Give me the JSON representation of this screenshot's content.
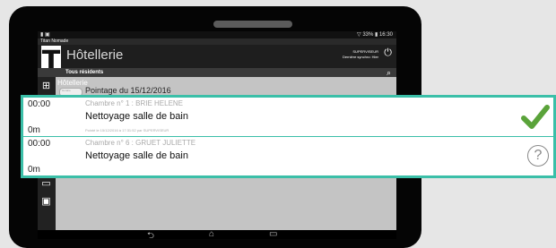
{
  "status": {
    "left": "▮ ▣",
    "right": "▽ 33% ▮ 16:30"
  },
  "app": {
    "name": "Titan Nomade"
  },
  "header": {
    "logo_letter": "T",
    "title": "Hôtellerie",
    "user_role": "SUPERVISEUR",
    "user_subtitle": "Dernière synchro: Hier"
  },
  "subheader": {
    "title": "Tous résidents"
  },
  "section": {
    "label": "Hôtellerie",
    "toggle": "Horaire",
    "pointage": "Pointage du 15/12/2016"
  },
  "tasks": [
    {
      "time": "00:00",
      "room": "Chambre n° 1 : BRIE HELENE",
      "task": "Nettoyage salle de bain",
      "duration": "0m",
      "meta": "Pointé le 15/12/2016 à 17:31:52 par SUPERVISEUR",
      "status": "done"
    },
    {
      "time": "00:00",
      "room": "Chambre n° 6 : GRUET JULIETTE",
      "task": "Nettoyage salle de bain",
      "duration": "0m",
      "meta": "",
      "status": "unknown"
    }
  ],
  "colors": {
    "accent": "#3bbfa8",
    "check": "#5aa33a"
  },
  "icons": {
    "back": "back-icon",
    "home": "home-icon",
    "recent": "recent-apps-icon"
  }
}
